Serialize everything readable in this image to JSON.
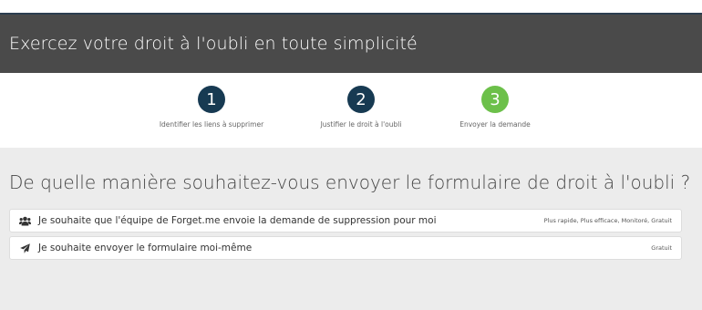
{
  "header": {
    "title": "Exercez votre droit à l'oubli en toute simplicité"
  },
  "steps": [
    {
      "number": "1",
      "label": "Identifier les liens à supprimer",
      "color": "#173a52"
    },
    {
      "number": "2",
      "label": "Justifier le droit à l'oubli",
      "color": "#173a52"
    },
    {
      "number": "3",
      "label": "Envoyer la demande",
      "color": "#6cc04a"
    }
  ],
  "main": {
    "question": "De quelle manière souhaitez-vous envoyer le formulaire de droit à l'oubli ?",
    "options": [
      {
        "icon": "users-icon",
        "label": "Je souhaite que l'équipe de Forget.me envoie la demande de suppression pour moi",
        "tags": "Plus rapide, Plus efficace, Monitoré, Gratuit"
      },
      {
        "icon": "paper-plane-icon",
        "label": "Je souhaite envoyer le formulaire moi-même",
        "tags": "Gratuit"
      }
    ]
  }
}
